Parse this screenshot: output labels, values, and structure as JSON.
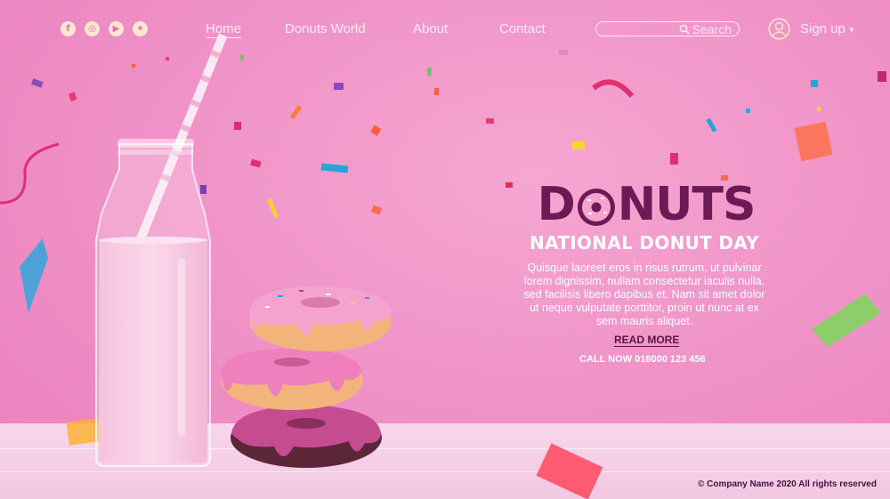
{
  "nav": {
    "socials": [
      {
        "icon": "facebook-icon",
        "glyph": "f"
      },
      {
        "icon": "instagram-icon",
        "glyph": "◎"
      },
      {
        "icon": "youtube-icon",
        "glyph": "▶"
      },
      {
        "icon": "twitter-icon",
        "glyph": "✦"
      }
    ],
    "links": [
      "Home",
      "Donuts World",
      "About",
      "Contact"
    ],
    "active_link": "Home",
    "search_label": "Search",
    "signup_label": "Sign up"
  },
  "hero": {
    "brand": "DONUTS",
    "subtitle": "NATIONAL DONUT DAY",
    "body": "Quisque laoreet eros in risus rutrum, ut pulvinar lorem dignissim, nullam consectetur iaculis nulla, sed facilisis libero dapibus et. Nam sit amet dolor ut neque vulputate porttitor, proin ut nunc at ex sem mauris aliquet.",
    "read_more": "READ MORE",
    "call_now": "CALL NOW 018000 123 456"
  },
  "footer": {
    "copyright": "© Company Name 2020 All rights reserved"
  },
  "colors": {
    "background": "#f094c8",
    "brand": "#6b1a55",
    "nav_text": "#fdebf5",
    "table": "#f5cfe5"
  }
}
